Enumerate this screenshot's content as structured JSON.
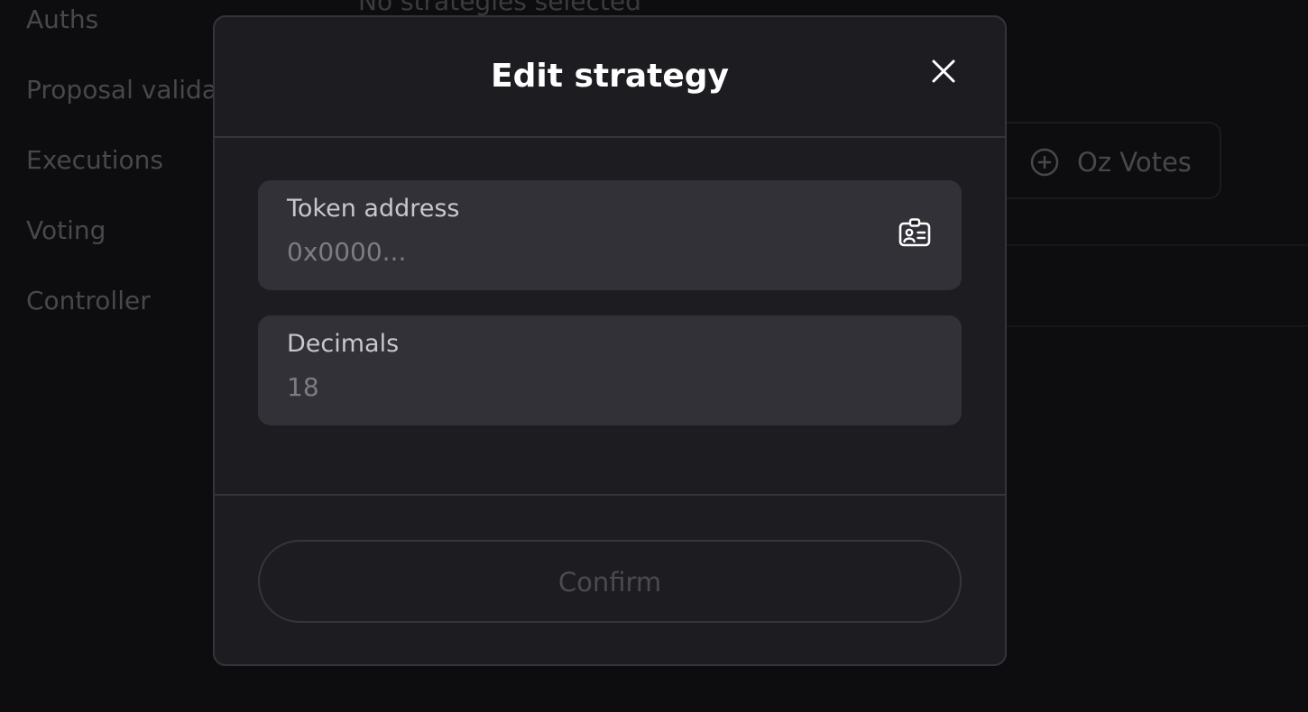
{
  "sidebar": {
    "items": [
      {
        "label": "Auths"
      },
      {
        "label": "Proposal valida"
      },
      {
        "label": "Executions"
      },
      {
        "label": "Voting"
      },
      {
        "label": "Controller"
      }
    ]
  },
  "background": {
    "status_text": "No strategies selected",
    "strategy_button_label": "Oz Votes"
  },
  "modal": {
    "title": "Edit strategy",
    "close_icon": "close-icon",
    "fields": [
      {
        "label": "Token address",
        "placeholder": "0x0000...",
        "value": "",
        "icon": "contact-card-icon"
      },
      {
        "label": "Decimals",
        "placeholder": "18",
        "value": ""
      }
    ],
    "confirm_label": "Confirm"
  },
  "colors": {
    "background": "#141316",
    "modal_bg": "#1d1c21",
    "field_bg": "#323137",
    "border": "#35343a",
    "title": "#ffffff",
    "muted_text": "#6f6d74",
    "disabled_text": "#4c4a51"
  }
}
